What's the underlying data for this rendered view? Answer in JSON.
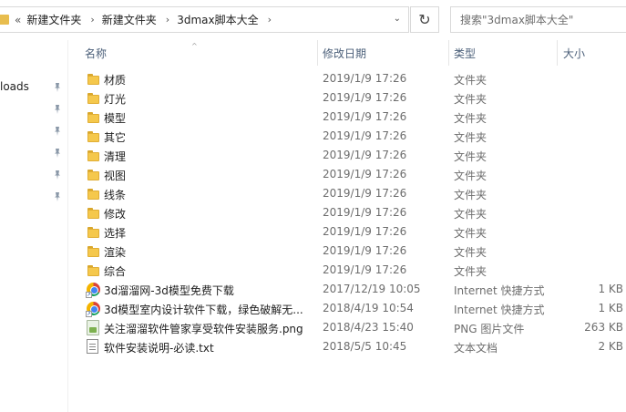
{
  "address": {
    "overflow": "«",
    "crumbs": [
      "新建文件夹",
      "新建文件夹",
      "3dmax脚本大全"
    ],
    "separator": "›",
    "dropdown": "⌄",
    "refresh": "↻"
  },
  "search": {
    "placeholder": "搜索\"3dmax脚本大全\""
  },
  "nav": {
    "quick_access_item": "loads",
    "pins": 6
  },
  "columns": {
    "name": "名称",
    "date": "修改日期",
    "type": "类型",
    "size": "大小"
  },
  "files": [
    {
      "name": "材质",
      "date": "2019/1/9 17:26",
      "type": "文件夹",
      "size": "",
      "icon": "folder-icon"
    },
    {
      "name": "灯光",
      "date": "2019/1/9 17:26",
      "type": "文件夹",
      "size": "",
      "icon": "folder-icon"
    },
    {
      "name": "模型",
      "date": "2019/1/9 17:26",
      "type": "文件夹",
      "size": "",
      "icon": "folder-icon"
    },
    {
      "name": "其它",
      "date": "2019/1/9 17:26",
      "type": "文件夹",
      "size": "",
      "icon": "folder-icon"
    },
    {
      "name": "清理",
      "date": "2019/1/9 17:26",
      "type": "文件夹",
      "size": "",
      "icon": "folder-icon"
    },
    {
      "name": "视图",
      "date": "2019/1/9 17:26",
      "type": "文件夹",
      "size": "",
      "icon": "folder-icon"
    },
    {
      "name": "线条",
      "date": "2019/1/9 17:26",
      "type": "文件夹",
      "size": "",
      "icon": "folder-icon"
    },
    {
      "name": "修改",
      "date": "2019/1/9 17:26",
      "type": "文件夹",
      "size": "",
      "icon": "folder-icon"
    },
    {
      "name": "选择",
      "date": "2019/1/9 17:26",
      "type": "文件夹",
      "size": "",
      "icon": "folder-icon"
    },
    {
      "name": "渲染",
      "date": "2019/1/9 17:26",
      "type": "文件夹",
      "size": "",
      "icon": "folder-icon"
    },
    {
      "name": "综合",
      "date": "2019/1/9 17:26",
      "type": "文件夹",
      "size": "",
      "icon": "folder-icon"
    },
    {
      "name": "3d溜溜网-3d模型免费下载",
      "date": "2017/12/19 10:05",
      "type": "Internet 快捷方式",
      "size": "1 KB",
      "icon": "chrome-shortcut-icon"
    },
    {
      "name": "3d模型室内设计软件下载，绿色破解无...",
      "date": "2018/4/19 10:54",
      "type": "Internet 快捷方式",
      "size": "1 KB",
      "icon": "chrome-shortcut-icon"
    },
    {
      "name": "关注溜溜软件管家享受软件安装服务.png",
      "date": "2018/4/23 15:40",
      "type": "PNG 图片文件",
      "size": "263 KB",
      "icon": "png-file-icon"
    },
    {
      "name": "软件安装说明-必读.txt",
      "date": "2018/5/5 10:45",
      "type": "文本文档",
      "size": "2 KB",
      "icon": "text-file-icon"
    }
  ]
}
